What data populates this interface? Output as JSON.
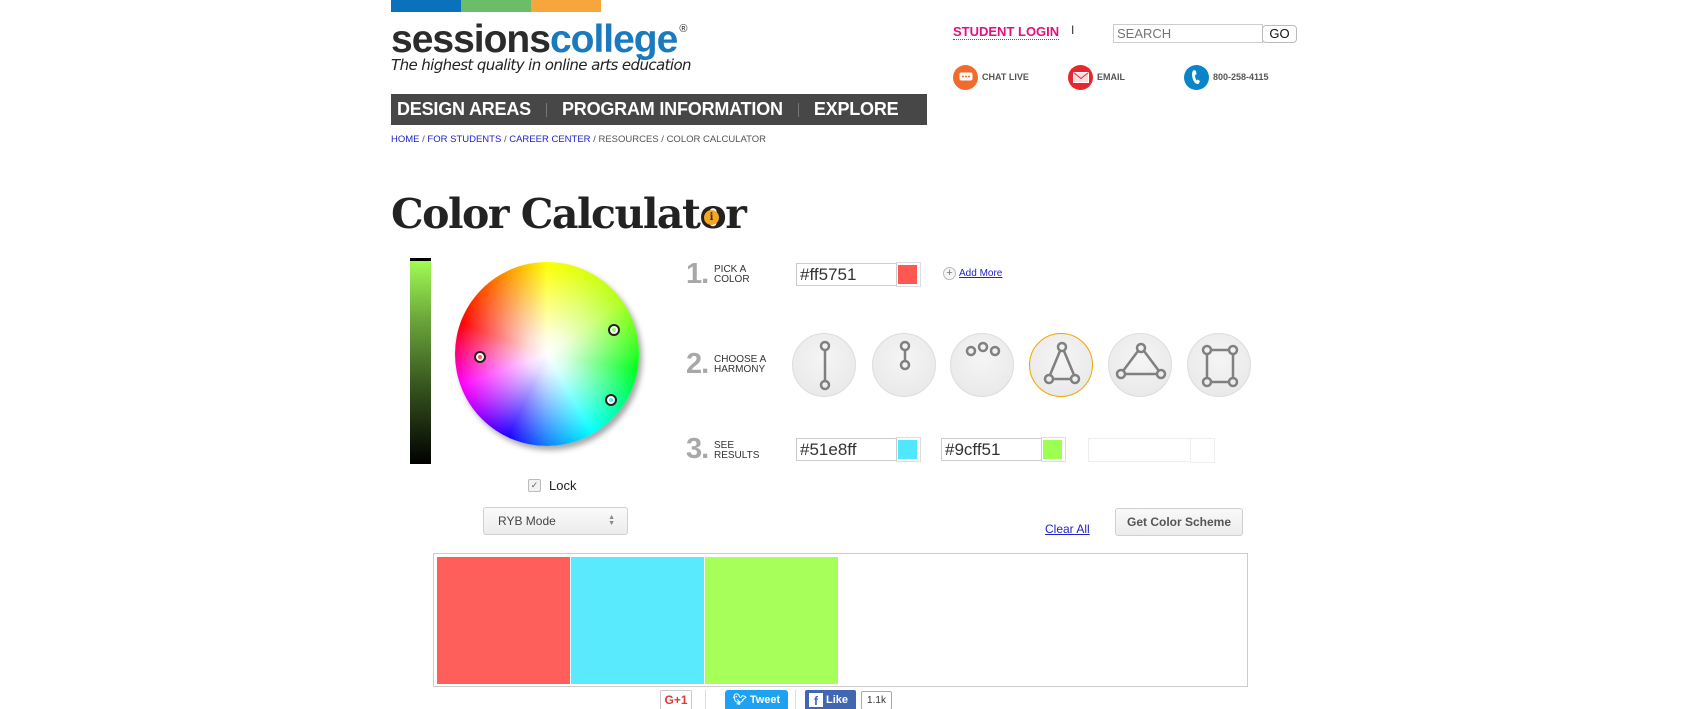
{
  "brand": {
    "bars": [
      "#0a72bd",
      "#6cbd6a",
      "#f6a63a"
    ],
    "logo_part1": "sessions",
    "logo_part2": "college",
    "logo_reg": "®",
    "tagline": "The highest quality in online arts education"
  },
  "nav": {
    "items": [
      {
        "label": "DESIGN AREAS"
      },
      {
        "label": "PROGRAM INFORMATION"
      },
      {
        "label": "EXPLORE"
      }
    ]
  },
  "breadcrumb": {
    "items": [
      {
        "label": "HOME",
        "link": true
      },
      {
        "label": "FOR STUDENTS",
        "link": true
      },
      {
        "label": "CAREER CENTER",
        "link": true
      },
      {
        "label": "RESOURCES",
        "link": false
      },
      {
        "label": "COLOR CALCULATOR",
        "link": false
      }
    ],
    "separator": " / "
  },
  "header": {
    "student_login": "STUDENT LOGIN",
    "pipe": "I",
    "search_placeholder": "SEARCH",
    "go_label": "GO",
    "contacts": [
      {
        "icon": "chat-icon",
        "label": "CHAT LIVE",
        "color": "#f26b2e"
      },
      {
        "icon": "email-icon",
        "label": "EMAIL",
        "color": "#e8262e"
      },
      {
        "icon": "phone-icon",
        "label": "800-258-4115",
        "color": "#0a84c8"
      }
    ]
  },
  "page": {
    "title": "Color Calculator",
    "info_icon": "i"
  },
  "picker": {
    "lock_label": "Lock",
    "lock_checked": true,
    "mode_selected": "RYB Mode",
    "value_slider_color": "#9cff51"
  },
  "steps": {
    "step1": {
      "num": "1.",
      "line1": "PICK A",
      "line2": "COLOR",
      "hex": "#ff5751",
      "color": "#ff5751",
      "add_more": "Add More"
    },
    "step2": {
      "num": "2.",
      "line1": "CHOOSE A",
      "line2": "HARMONY",
      "harmonies": [
        {
          "name": "complementary",
          "selected": false
        },
        {
          "name": "monochromatic",
          "selected": false
        },
        {
          "name": "analogous",
          "selected": false
        },
        {
          "name": "split-complementary",
          "selected": true
        },
        {
          "name": "triad",
          "selected": false
        },
        {
          "name": "tetrad",
          "selected": false
        }
      ]
    },
    "step3": {
      "num": "3.",
      "line1": "SEE",
      "line2": "RESULTS",
      "results": [
        {
          "hex": "#51e8ff",
          "color": "#51e8ff"
        },
        {
          "hex": "#9cff51",
          "color": "#9cff51"
        },
        {
          "hex": "",
          "color": ""
        }
      ]
    }
  },
  "actions": {
    "clear_all": "Clear All",
    "get_scheme": "Get Color Scheme"
  },
  "scheme_panel": {
    "colors": [
      "#ff5f5a",
      "#5aeafd",
      "#a7ff5a"
    ]
  },
  "share": {
    "gplus": "G+1",
    "tweet": "Tweet",
    "like": "Like",
    "like_count": "1.1k"
  }
}
